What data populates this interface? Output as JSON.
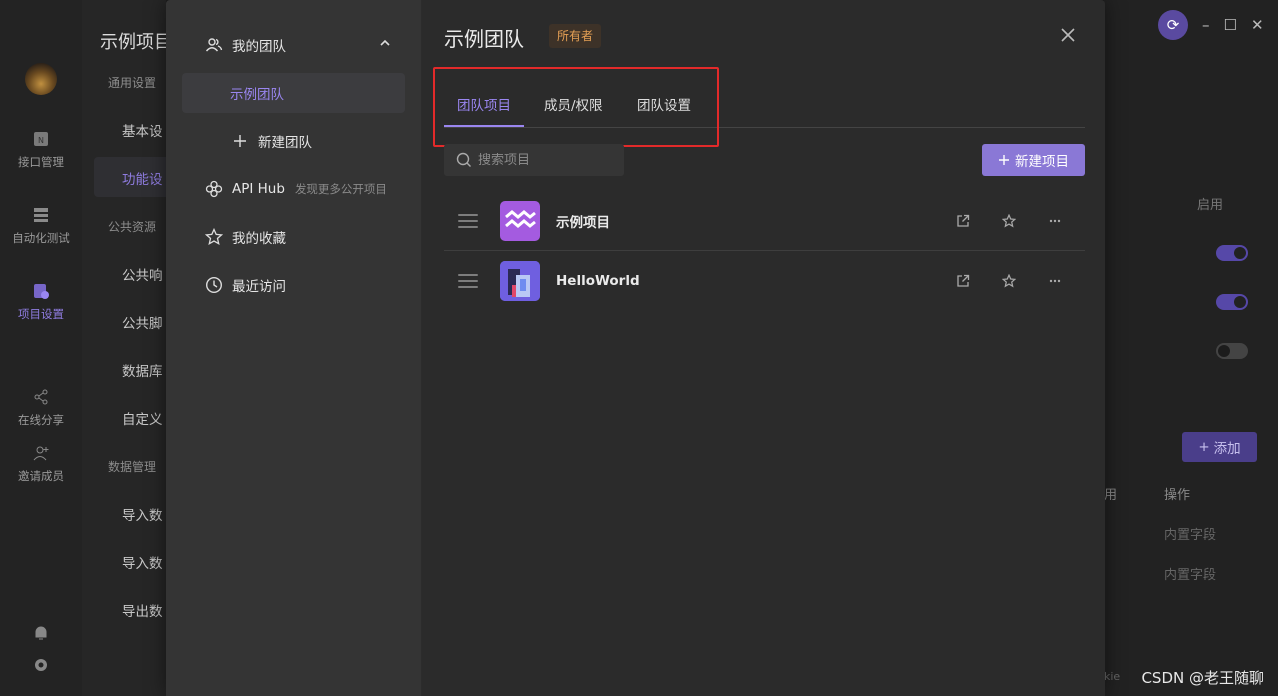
{
  "background": {
    "project_title": "示例项目",
    "rail": [
      {
        "label": "接口管理",
        "icon": "api-icon"
      },
      {
        "label": "自动化测试",
        "icon": "automation-icon"
      },
      {
        "label": "项目设置",
        "icon": "settings-icon"
      },
      {
        "label": "在线分享",
        "icon": "share-icon"
      },
      {
        "label": "邀请成员",
        "icon": "add-user-icon"
      }
    ],
    "sections": {
      "general": "通用设置",
      "basic": "基本设",
      "features": "功能设",
      "public": "公共资源",
      "public_resp": "公共响",
      "public_script": "公共脚",
      "database": "数据库",
      "custom": "自定义",
      "data_mgmt": "数据管理",
      "import1": "导入数",
      "import2": "导入数",
      "export": "导出数"
    },
    "right": {
      "enable_label": "启用",
      "add_label": "添加",
      "col_enabled": "用",
      "col_ops": "操作",
      "builtin1": "内置字段",
      "builtin2": "内置字段",
      "cookie_fragment": "kie"
    }
  },
  "sidebar": {
    "my_team": "我的团队",
    "example_team": "示例团队",
    "new_team": "新建团队",
    "api_hub": "API Hub",
    "api_hub_hint": "发现更多公开项目",
    "favorites": "我的收藏",
    "recent": "最近访问"
  },
  "header": {
    "title": "示例团队",
    "owner_badge": "所有者"
  },
  "tabs": [
    {
      "label": "团队项目",
      "active": true
    },
    {
      "label": "成员/权限",
      "active": false
    },
    {
      "label": "团队设置",
      "active": false
    }
  ],
  "search": {
    "placeholder": "搜索项目",
    "value": ""
  },
  "new_project_label": "新建项目",
  "projects": [
    {
      "name": "示例项目",
      "icon": "aquarius-icon",
      "color": "#a45be0"
    },
    {
      "name": "HelloWorld",
      "icon": "building-icon",
      "color": "#6f5fe0"
    }
  ],
  "watermark": "CSDN @老王随聊",
  "colors": {
    "accent": "#9a86f0",
    "button": "#8a78d6",
    "owner_text": "#e5a055",
    "highlight": "#e32a2a"
  }
}
